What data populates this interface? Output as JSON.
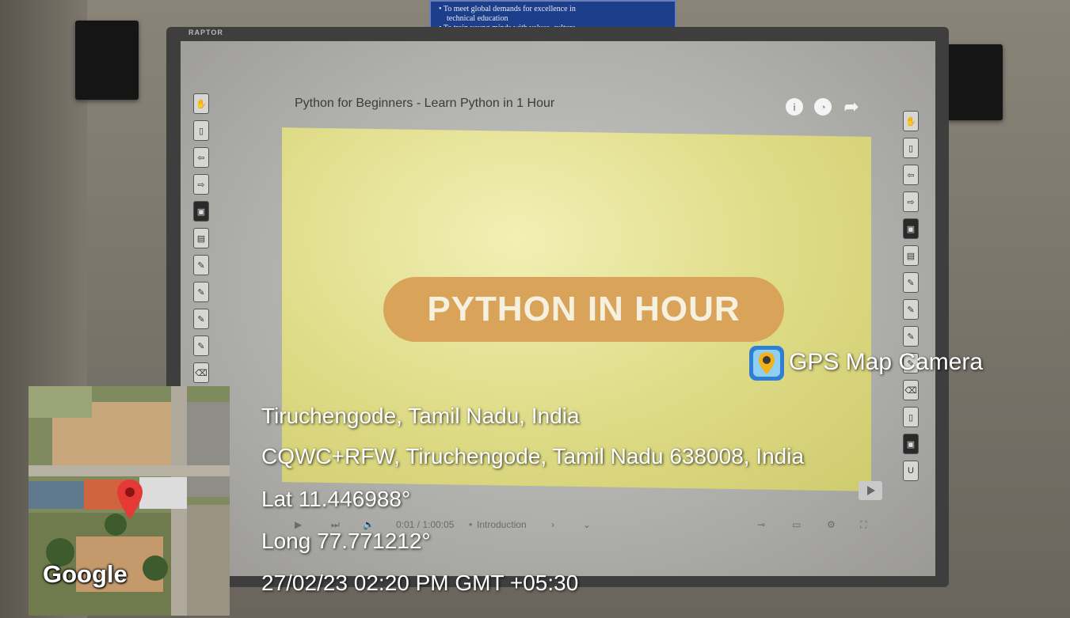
{
  "notice": {
    "line1": "• To meet global demands for excellence in",
    "line2": "technical education",
    "line3": "• To train young minds with values, culture,"
  },
  "board": {
    "brand": "RAPTOR"
  },
  "video": {
    "title": "Python for Beginners - Learn Python in 1 Hour",
    "slide_text": "PYTHON IN HOUR",
    "icons": [
      "info-icon",
      "clock-icon",
      "share-icon"
    ],
    "time": "0:01 / 1:00:05",
    "chapter": "Introduction",
    "accent_color": "#d9a35a",
    "screen_color": "#e6e394"
  },
  "overlay": {
    "app_name": "GPS Map Camera",
    "place": "Tiruchengode, Tamil Nadu, India",
    "address": "CQWC+RFW, Tiruchengode, Tamil Nadu 638008, India",
    "lat": "Lat 11.446988°",
    "long": "Long 77.771212°",
    "datetime": "27/02/23 02:20 PM GMT +05:30"
  },
  "map": {
    "attribution": "Google",
    "marker_color": "#e53935"
  }
}
